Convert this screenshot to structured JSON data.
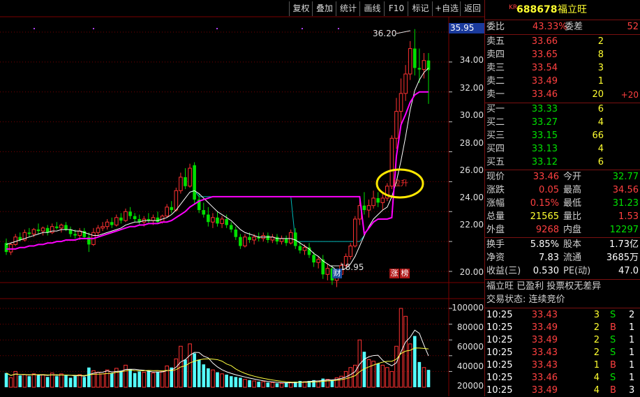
{
  "toolbar": {
    "items": [
      "复权",
      "叠加",
      "统计",
      "画线",
      "F10",
      "标记",
      "+自选",
      "返回"
    ]
  },
  "stock": {
    "prefix": "KR",
    "code": "688678",
    "name": "福立旺"
  },
  "price_axis": {
    "current_tag": "35.95",
    "ticks": [
      "36.00",
      "34.00",
      "32.00",
      "30.00",
      "28.00",
      "26.00",
      "24.00",
      "22.00",
      "20.00"
    ],
    "high_label": "36.20",
    "low_label": "18.95",
    "badges": [
      "财",
      "涨",
      "榜"
    ],
    "annotation": "拉升"
  },
  "volume_axis": {
    "ticks": [
      "100000",
      "80000",
      "60000",
      "40000",
      "20000"
    ]
  },
  "colors": {
    "up": "#ff3232",
    "down": "#54ffff",
    "down_candle": "#00e000",
    "ma_white": "#ffffff",
    "ma_magenta": "#ff00ff",
    "ma_cyan": "#00b8b8",
    "highlight": "#ffe800",
    "grid": "#7a0000"
  },
  "quote": {
    "weibi_label": "委比",
    "weibi": "43.33%",
    "weicha_label": "委差",
    "weicha": "52",
    "sells": [
      {
        "label": "卖五",
        "price": "33.66",
        "vol": "2",
        "chg": ""
      },
      {
        "label": "卖四",
        "price": "33.65",
        "vol": "8",
        "chg": ""
      },
      {
        "label": "卖三",
        "price": "33.54",
        "vol": "3",
        "chg": ""
      },
      {
        "label": "卖二",
        "price": "33.49",
        "vol": "1",
        "chg": ""
      },
      {
        "label": "卖一",
        "price": "33.46",
        "vol": "20",
        "chg": "+20"
      }
    ],
    "buys": [
      {
        "label": "买一",
        "price": "33.33",
        "vol": "6"
      },
      {
        "label": "买二",
        "price": "33.27",
        "vol": "4"
      },
      {
        "label": "买三",
        "price": "33.15",
        "vol": "66"
      },
      {
        "label": "买四",
        "price": "33.13",
        "vol": "4"
      },
      {
        "label": "买五",
        "price": "33.12",
        "vol": "6"
      }
    ],
    "stats": [
      {
        "l1": "现价",
        "v1": "33.46",
        "c1": "red",
        "l2": "今开",
        "v2": "32.77",
        "c2": "grn"
      },
      {
        "l1": "涨跌",
        "v1": "0.05",
        "c1": "red",
        "l2": "最高",
        "v2": "34.56",
        "c2": "red"
      },
      {
        "l1": "涨幅",
        "v1": "0.15%",
        "c1": "red",
        "l2": "最低",
        "v2": "31.23",
        "c2": "grn"
      },
      {
        "l1": "总量",
        "v1": "21565",
        "c1": "yel",
        "l2": "量比",
        "v2": "1.53",
        "c2": "red"
      },
      {
        "l1": "外盘",
        "v1": "9268",
        "c1": "red",
        "l2": "内盘",
        "v2": "12297",
        "c2": "grn"
      }
    ],
    "fund": [
      {
        "l1": "换手",
        "v1": "5.85%",
        "l2": "股本",
        "v2": "1.73亿"
      },
      {
        "l1": "净资",
        "v1": "7.83",
        "l2": "流通",
        "v2": "3685万"
      },
      {
        "l1": "收益(三)",
        "v1": "0.530",
        "l2": "PE(动)",
        "v2": "47.0"
      }
    ],
    "info_line1": "福立旺 已盈利 投票权无差异",
    "info_line2": "交易状态: 连续竞价",
    "ticks": [
      {
        "time": "10:25",
        "price": "33.43",
        "vol": "3",
        "side": "S",
        "n": "2"
      },
      {
        "time": "10:25",
        "price": "33.49",
        "vol": "2",
        "side": "B",
        "n": "1"
      },
      {
        "time": "10:25",
        "price": "33.49",
        "vol": "2",
        "side": "S",
        "n": "1"
      },
      {
        "time": "10:25",
        "price": "33.43",
        "vol": "2",
        "side": "S",
        "n": "1"
      },
      {
        "time": "10:25",
        "price": "33.43",
        "vol": "1",
        "side": "B",
        "n": "1"
      },
      {
        "time": "10:25",
        "price": "33.46",
        "vol": "4",
        "side": "S",
        "n": "1"
      },
      {
        "time": "10:25",
        "price": "33.49",
        "vol": "4",
        "side": "B",
        "n": "3"
      }
    ]
  },
  "chart_data": {
    "type": "candlestick",
    "ylim": [
      18.5,
      37.0
    ],
    "candles": [
      [
        21.9,
        22.2,
        21.1,
        21.3
      ],
      [
        21.3,
        21.9,
        21.1,
        21.8
      ],
      [
        21.8,
        22.5,
        21.7,
        22.3
      ],
      [
        22.3,
        22.6,
        22.0,
        22.1
      ],
      [
        22.1,
        22.8,
        22.0,
        22.6
      ],
      [
        22.6,
        22.9,
        22.3,
        22.5
      ],
      [
        22.5,
        22.9,
        22.3,
        22.8
      ],
      [
        22.8,
        23.2,
        22.5,
        22.7
      ],
      [
        22.7,
        23.0,
        22.4,
        22.9
      ],
      [
        22.9,
        23.1,
        22.4,
        22.6
      ],
      [
        22.6,
        23.2,
        22.5,
        23.0
      ],
      [
        23.0,
        23.3,
        22.8,
        22.9
      ],
      [
        22.9,
        23.2,
        22.6,
        23.1
      ],
      [
        23.1,
        23.3,
        22.7,
        22.8
      ],
      [
        22.8,
        23.0,
        22.3,
        22.5
      ],
      [
        22.5,
        22.8,
        22.2,
        22.4
      ],
      [
        22.4,
        22.9,
        22.1,
        22.7
      ],
      [
        22.7,
        22.9,
        22.2,
        22.3
      ],
      [
        22.3,
        22.6,
        21.3,
        21.8
      ],
      [
        21.8,
        22.9,
        21.7,
        22.6
      ],
      [
        22.6,
        23.1,
        22.4,
        22.9
      ],
      [
        22.9,
        23.3,
        22.7,
        23.0
      ],
      [
        23.0,
        23.5,
        22.8,
        23.3
      ],
      [
        23.3,
        23.6,
        22.9,
        23.1
      ],
      [
        23.1,
        23.8,
        23.0,
        23.6
      ],
      [
        23.6,
        23.9,
        23.2,
        23.4
      ],
      [
        23.4,
        24.2,
        23.3,
        24.0
      ],
      [
        24.0,
        24.3,
        23.5,
        23.7
      ],
      [
        23.7,
        23.9,
        23.3,
        23.5
      ],
      [
        23.5,
        23.8,
        23.1,
        23.3
      ],
      [
        23.3,
        23.7,
        23.0,
        23.5
      ],
      [
        23.5,
        23.9,
        23.2,
        23.4
      ],
      [
        23.4,
        23.8,
        23.1,
        23.6
      ],
      [
        23.6,
        24.0,
        23.2,
        23.3
      ],
      [
        23.3,
        23.8,
        23.2,
        23.7
      ],
      [
        23.7,
        24.5,
        23.6,
        24.3
      ],
      [
        24.3,
        24.7,
        23.9,
        24.1
      ],
      [
        24.1,
        25.6,
        24.0,
        25.4
      ],
      [
        25.4,
        26.6,
        25.2,
        26.3
      ],
      [
        26.3,
        26.9,
        25.5,
        25.7
      ],
      [
        25.7,
        27.2,
        25.6,
        26.9
      ],
      [
        27.1,
        27.3,
        24.5,
        24.8
      ],
      [
        24.8,
        25.2,
        23.9,
        24.1
      ],
      [
        24.1,
        24.6,
        23.6,
        23.8
      ],
      [
        23.8,
        24.3,
        23.0,
        23.3
      ],
      [
        23.3,
        23.9,
        22.9,
        23.6
      ],
      [
        23.6,
        24.0,
        23.0,
        23.2
      ],
      [
        23.2,
        23.7,
        22.9,
        23.5
      ],
      [
        23.5,
        23.8,
        22.9,
        23.1
      ],
      [
        23.1,
        23.3,
        22.6,
        22.8
      ],
      [
        22.8,
        23.0,
        22.1,
        22.3
      ],
      [
        22.3,
        22.5,
        21.5,
        21.7
      ],
      [
        21.7,
        22.5,
        21.6,
        22.3
      ],
      [
        22.3,
        22.6,
        21.9,
        22.1
      ],
      [
        22.1,
        22.5,
        21.8,
        22.3
      ],
      [
        22.3,
        22.6,
        22.0,
        22.2
      ],
      [
        22.2,
        22.6,
        22.0,
        22.4
      ],
      [
        22.4,
        22.6,
        21.9,
        22.1
      ],
      [
        22.1,
        22.5,
        21.9,
        22.3
      ],
      [
        22.3,
        22.5,
        21.8,
        22.0
      ],
      [
        22.0,
        22.4,
        21.8,
        22.2
      ],
      [
        22.2,
        22.4,
        21.7,
        21.9
      ],
      [
        21.9,
        22.8,
        21.8,
        22.6
      ],
      [
        22.6,
        22.9,
        21.5,
        21.7
      ],
      [
        21.7,
        22.0,
        21.2,
        21.4
      ],
      [
        21.4,
        21.8,
        21.1,
        21.6
      ],
      [
        21.6,
        21.9,
        20.9,
        21.1
      ],
      [
        21.1,
        21.3,
        20.3,
        20.6
      ],
      [
        20.6,
        21.0,
        20.2,
        20.8
      ],
      [
        20.8,
        21.1,
        19.5,
        19.8
      ],
      [
        19.8,
        20.5,
        19.4,
        20.2
      ],
      [
        20.2,
        20.4,
        19.1,
        19.4
      ],
      [
        19.4,
        20.0,
        18.95,
        19.8
      ],
      [
        19.8,
        20.6,
        19.6,
        20.4
      ],
      [
        20.4,
        21.2,
        20.2,
        21.0
      ],
      [
        21.0,
        21.9,
        20.8,
        21.7
      ],
      [
        21.7,
        23.7,
        21.6,
        23.5
      ],
      [
        23.5,
        24.8,
        23.1,
        24.4
      ],
      [
        24.4,
        25.3,
        23.8,
        24.1
      ],
      [
        24.1,
        24.8,
        23.6,
        24.4
      ],
      [
        24.4,
        25.4,
        24.2,
        24.9
      ],
      [
        24.9,
        25.3,
        24.3,
        24.6
      ],
      [
        24.6,
        25.2,
        24.1,
        24.9
      ],
      [
        24.9,
        25.9,
        24.7,
        25.7
      ],
      [
        25.7,
        29.1,
        25.5,
        28.9
      ],
      [
        28.9,
        31.6,
        28.2,
        30.7
      ],
      [
        30.7,
        32.9,
        29.9,
        31.9
      ],
      [
        31.9,
        33.8,
        31.4,
        33.2
      ],
      [
        33.2,
        35.4,
        32.8,
        34.9
      ],
      [
        34.9,
        36.2,
        33.1,
        33.6
      ],
      [
        33.6,
        34.9,
        32.6,
        33.5
      ],
      [
        33.5,
        34.6,
        32.9,
        34.1
      ],
      [
        34.1,
        34.6,
        31.2,
        33.46
      ]
    ],
    "ma_white": [
      21.8,
      21.9,
      22.0,
      22.1,
      22.2,
      22.3,
      22.4,
      22.5,
      22.6,
      22.6,
      22.7,
      22.7,
      22.8,
      22.8,
      22.8,
      22.7,
      22.7,
      22.6,
      22.5,
      22.4,
      22.4,
      22.5,
      22.6,
      22.7,
      22.8,
      22.9,
      23.1,
      23.2,
      23.3,
      23.3,
      23.4,
      23.4,
      23.4,
      23.4,
      23.5,
      23.6,
      23.8,
      24.1,
      24.5,
      24.9,
      25.3,
      25.4,
      25.2,
      24.9,
      24.6,
      24.3,
      24.0,
      23.8,
      23.6,
      23.4,
      23.1,
      22.8,
      22.6,
      22.5,
      22.4,
      22.3,
      22.3,
      22.3,
      22.3,
      22.2,
      22.2,
      22.2,
      22.2,
      22.1,
      21.9,
      21.7,
      21.5,
      21.2,
      21.0,
      20.7,
      20.5,
      20.3,
      20.1,
      20.1,
      20.2,
      20.5,
      21.0,
      21.7,
      22.4,
      23.0,
      23.5,
      23.8,
      24.1,
      24.3,
      25.0,
      26.0,
      27.4,
      29.0,
      30.8,
      32.1,
      32.8,
      33.3,
      33.6
    ],
    "ma_magenta": [
      21.5,
      21.5,
      21.5,
      21.6,
      21.6,
      21.7,
      21.7,
      21.8,
      21.8,
      21.9,
      21.9,
      22.0,
      22.0,
      22.1,
      22.1,
      22.1,
      22.2,
      22.2,
      22.2,
      22.2,
      22.3,
      22.4,
      22.5,
      22.6,
      22.7,
      22.8,
      22.9,
      23.0,
      23.0,
      23.1,
      23.1,
      23.2,
      23.2,
      23.2,
      23.3,
      23.3,
      23.4,
      23.6,
      23.8,
      24.0,
      24.3,
      24.5,
      24.7,
      24.8,
      24.9,
      25.0,
      25.0,
      25.0,
      25.0,
      25.0,
      25.0,
      25.0,
      25.0,
      25.0,
      25.0,
      25.0,
      25.0,
      25.0,
      25.0,
      25.0,
      25.0,
      25.0,
      25.0,
      25.0,
      25.0,
      25.0,
      25.0,
      25.0,
      25.0,
      25.0,
      25.0,
      25.0,
      25.0,
      25.0,
      25.0,
      25.0,
      25.0,
      25.0,
      22.5,
      22.9,
      23.3,
      23.5,
      23.5,
      23.5,
      23.6,
      27.7,
      29.8,
      30.5,
      31.3,
      31.8,
      32.0,
      32.0,
      32.0
    ],
    "volume": [
      18000,
      12000,
      20000,
      15000,
      16000,
      14000,
      17000,
      15000,
      16000,
      13000,
      18000,
      14000,
      17000,
      15000,
      12000,
      14000,
      16000,
      13000,
      25000,
      21000,
      19000,
      17000,
      22000,
      18000,
      24000,
      21000,
      28000,
      23000,
      18000,
      20000,
      19000,
      21000,
      18000,
      19000,
      20000,
      27000,
      25000,
      36000,
      52000,
      35000,
      55000,
      43000,
      35000,
      29000,
      24000,
      22000,
      19000,
      17000,
      16000,
      14000,
      13000,
      12000,
      10000,
      9000,
      8000,
      7000,
      7000,
      6000,
      6000,
      5000,
      5000,
      6000,
      6000,
      7000,
      8000,
      7000,
      8000,
      9000,
      8000,
      11000,
      10000,
      9000,
      12000,
      14000,
      20000,
      25000,
      28000,
      60000,
      45000,
      35000,
      33000,
      30000,
      28000,
      25000,
      20000,
      52000,
      100000,
      90000,
      55000,
      65000,
      32000,
      25000,
      22000
    ]
  }
}
